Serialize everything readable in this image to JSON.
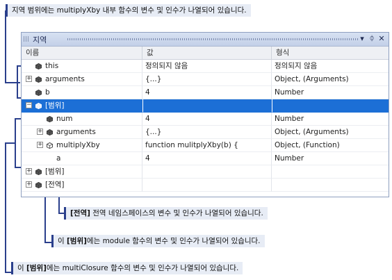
{
  "callouts": {
    "top": "지역 범위에는 multiplyXby 내부 함수의 변수 및 인수가 나열되어 있습니다.",
    "global_bold": "[전역]",
    "global_rest": " 전역 네임스페이스의 변수 및 인수가 나열되어 있습니다.",
    "module_pre": "이 ",
    "module_bold": "[범위]",
    "module_rest": "에는 module 함수의 변수 및 인수가 나열되어 있습니다.",
    "closure_pre": "이 ",
    "closure_bold": "[범위]",
    "closure_rest": "에는 multiClosure 함수의 변수 및 인수가 나열되어 있습니다."
  },
  "window": {
    "title": "지역",
    "dropdown_glyph": "▾",
    "pin_glyph": "ᛰ",
    "close_glyph": "✕"
  },
  "columns": {
    "name": "이름",
    "value": "값",
    "type": "형식"
  },
  "rows": [
    {
      "name": "this",
      "value": "정의되지 않음",
      "type": "정의되지 않음",
      "expander": "",
      "indent": 0
    },
    {
      "name": "arguments",
      "value": "{...}",
      "type": "Object, (Arguments)",
      "expander": "+",
      "indent": 0
    },
    {
      "name": "b",
      "value": "4",
      "type": "Number",
      "expander": "",
      "indent": 0
    },
    {
      "name": "[범위]",
      "value": "",
      "type": "",
      "expander": "−",
      "indent": 0,
      "selected": true
    },
    {
      "name": "num",
      "value": "4",
      "type": "Number",
      "expander": "",
      "indent": 1
    },
    {
      "name": "arguments",
      "value": "{...}",
      "type": "Object, (Arguments)",
      "expander": "+",
      "indent": 1
    },
    {
      "name": "multiplyXby",
      "value": "function mulitplyXby(b) {",
      "type": "Object, (Function)",
      "expander": "+",
      "indent": 1,
      "icon": "function"
    },
    {
      "name": "a",
      "value": "4",
      "type": "Number",
      "expander": "",
      "indent": 1,
      "icon": "none"
    },
    {
      "name": "[범위]",
      "value": "",
      "type": "",
      "expander": "+",
      "indent": 0
    },
    {
      "name": "[전역]",
      "value": "",
      "type": "",
      "expander": "+",
      "indent": 0
    }
  ],
  "colors": {
    "accent": "#2a3f8c",
    "selection": "#1c6fd6"
  }
}
